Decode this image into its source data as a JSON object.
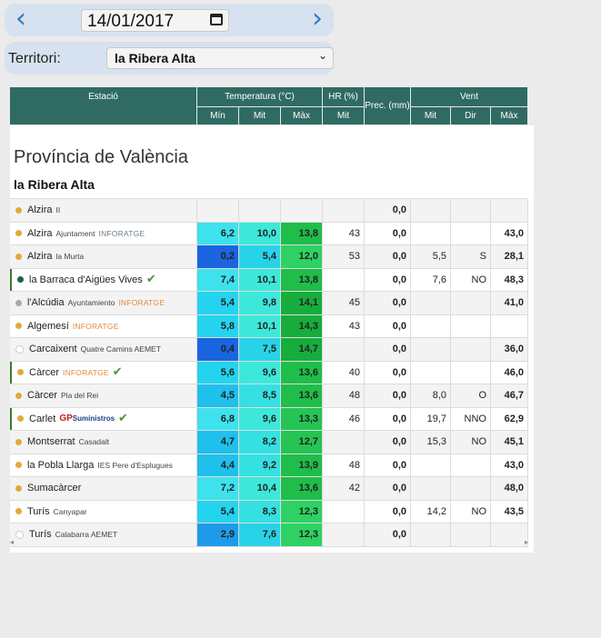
{
  "nav": {
    "prev_icon": "‹",
    "next_icon": "›",
    "date": "14/01/2017",
    "calendar_icon": "calendar-icon"
  },
  "territory": {
    "label": "Territori:",
    "selected": "la Ribera Alta",
    "chevron": "⌄"
  },
  "table_header": {
    "station": "Estació",
    "temperature": "Temperatura (°C)",
    "hr": "HR (%)",
    "prec": "Prec. (mm)",
    "wind": "Vent",
    "min": "Mín",
    "mit": "Mit",
    "max": "Màx",
    "hr_mit": "Mit",
    "wind_mit": "Mit",
    "wind_dir": "Dir",
    "wind_max": "Màx"
  },
  "province": "Província de València",
  "region": "la Ribera Alta",
  "rows": [
    {
      "name": "Alzira",
      "sub": "II",
      "tag": "",
      "dot": "#e3a93a",
      "tmin": "",
      "tmit": "",
      "tmax": "",
      "hr": "",
      "prec": "0,0",
      "wmit": "",
      "wdir": "",
      "wmax": "",
      "check": false
    },
    {
      "name": "Alzira",
      "sub": "Ajuntament",
      "tag": "INFORATGE",
      "dot": "#e3a93a",
      "tmin": "6,2",
      "tmit": "10,0",
      "tmax": "13,8",
      "hr": "43",
      "prec": "0,0",
      "wmit": "",
      "wdir": "",
      "wmax": "43,0",
      "check": false
    },
    {
      "name": "Alzira",
      "sub": "la Murta",
      "tag": "",
      "dot": "#e3a93a",
      "tmin": "0,2",
      "tmit": "5,4",
      "tmax": "12,0",
      "hr": "53",
      "prec": "0,0",
      "wmit": "5,5",
      "wdir": "S",
      "wmax": "28,1",
      "check": false
    },
    {
      "name": "la Barraca d'Aigües Vives",
      "sub": "",
      "tag": "",
      "dot": "#1f5e57",
      "tmin": "7,4",
      "tmit": "10,1",
      "tmax": "13,8",
      "hr": "",
      "prec": "0,0",
      "wmit": "7,6",
      "wdir": "NO",
      "wmax": "48,3",
      "check": true
    },
    {
      "name": "l'Alcúdia",
      "sub": "Ayuntamiento",
      "tag": "INFORATGE",
      "dot": "#a9a9a9",
      "tmin": "5,4",
      "tmit": "9,8",
      "tmax": "14,1",
      "hr": "45",
      "prec": "0,0",
      "wmit": "",
      "wdir": "",
      "wmax": "41,0",
      "check": false
    },
    {
      "name": "Algemesí",
      "sub": "",
      "tag": "INFORATGE",
      "dot": "#e3a93a",
      "tmin": "5,8",
      "tmit": "10,1",
      "tmax": "14,3",
      "hr": "43",
      "prec": "0,0",
      "wmit": "",
      "wdir": "",
      "wmax": "",
      "check": false
    },
    {
      "name": "Carcaixent",
      "sub": "Quatre Camins AEMET",
      "tag": "",
      "dot": "#ffffff",
      "tmin": "0,4",
      "tmit": "7,5",
      "tmax": "14,7",
      "hr": "",
      "prec": "0,0",
      "wmit": "",
      "wdir": "",
      "wmax": "36,0",
      "check": false
    },
    {
      "name": "Càrcer",
      "sub": "",
      "tag": "INFORATGE",
      "dot": "#e3a93a",
      "tmin": "5,6",
      "tmit": "9,6",
      "tmax": "13,6",
      "hr": "40",
      "prec": "0,0",
      "wmit": "",
      "wdir": "",
      "wmax": "46,0",
      "check": true
    },
    {
      "name": "Càrcer",
      "sub": "Pla del Rei",
      "tag": "",
      "dot": "#e3a93a",
      "tmin": "4,5",
      "tmit": "8,5",
      "tmax": "13,6",
      "hr": "48",
      "prec": "0,0",
      "wmit": "8,0",
      "wdir": "O",
      "wmax": "46,7",
      "check": false
    },
    {
      "name": "Carlet",
      "sub": "",
      "tag": "GP",
      "dot": "#e3a93a",
      "tmin": "6,8",
      "tmit": "9,6",
      "tmax": "13,3",
      "hr": "46",
      "prec": "0,0",
      "wmit": "19,7",
      "wdir": "NNO",
      "wmax": "62,9",
      "check": true
    },
    {
      "name": "Montserrat",
      "sub": "Casadalt",
      "tag": "",
      "dot": "#e3a93a",
      "tmin": "4,7",
      "tmit": "8,2",
      "tmax": "12,7",
      "hr": "",
      "prec": "0,0",
      "wmit": "15,3",
      "wdir": "NO",
      "wmax": "45,1",
      "check": false
    },
    {
      "name": "la Pobla Llarga",
      "sub": "IES Pere d'Esplugues",
      "tag": "",
      "dot": "#e3a93a",
      "tmin": "4,4",
      "tmit": "9,2",
      "tmax": "13,9",
      "hr": "48",
      "prec": "0,0",
      "wmit": "",
      "wdir": "",
      "wmax": "43,0",
      "check": false
    },
    {
      "name": "Sumacàrcer",
      "sub": "",
      "tag": "",
      "dot": "#e3a93a",
      "tmin": "7,2",
      "tmit": "10,4",
      "tmax": "13,6",
      "hr": "42",
      "prec": "0,0",
      "wmit": "",
      "wdir": "",
      "wmax": "48,0",
      "check": false
    },
    {
      "name": "Turís",
      "sub": "Canyapar",
      "tag": "",
      "dot": "#e3a93a",
      "tmin": "5,4",
      "tmit": "8,3",
      "tmax": "12,3",
      "hr": "",
      "prec": "0,0",
      "wmit": "14,2",
      "wdir": "NO",
      "wmax": "43,5",
      "check": false
    },
    {
      "name": "Turís",
      "sub": "Calabarra AEMET",
      "tag": "",
      "dot": "#ffffff",
      "tmin": "2,9",
      "tmit": "7,6",
      "tmax": "12,3",
      "hr": "",
      "prec": "0,0",
      "wmit": "",
      "wdir": "",
      "wmax": "",
      "check": false
    }
  ],
  "gp_text": {
    "g": "GP",
    "rest": "Suministros"
  },
  "scroll": {
    "left": "◂",
    "right": "▸"
  }
}
